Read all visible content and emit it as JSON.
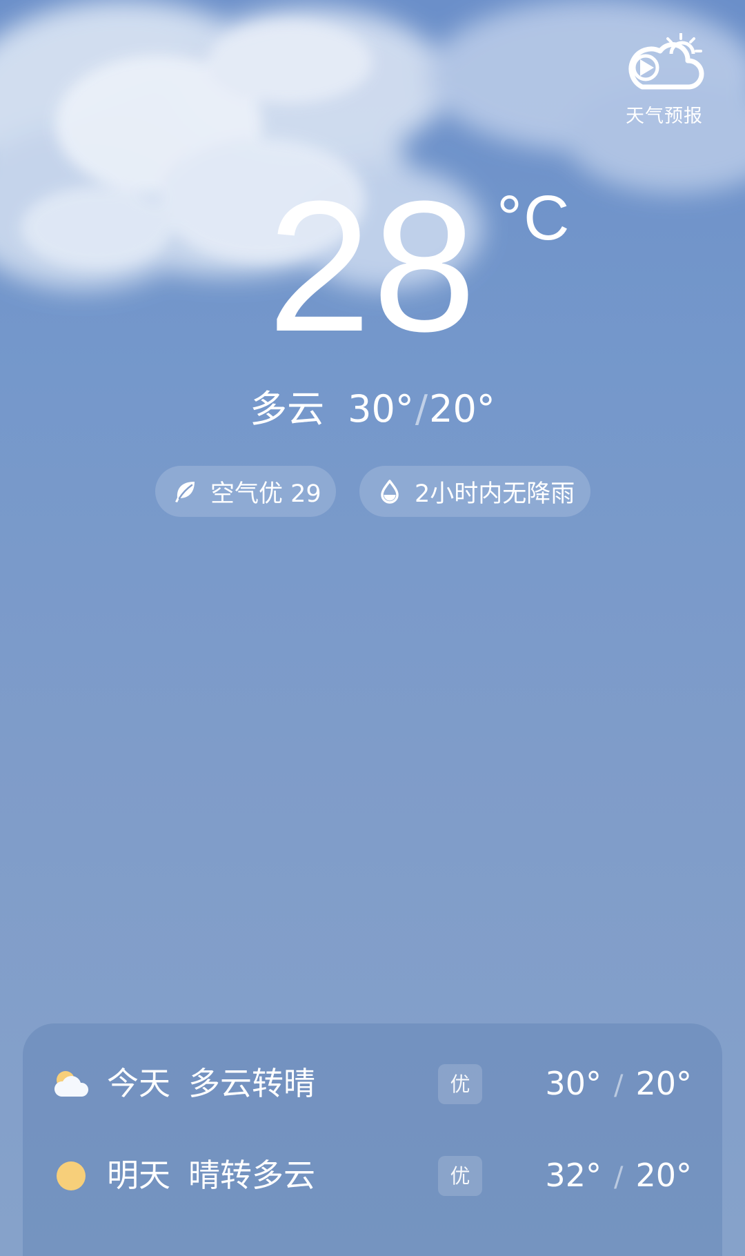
{
  "app": {
    "logo_icon": "video-weather-logo-icon",
    "logo_label": "天气预报"
  },
  "current": {
    "temperature": "28",
    "unit": "°C",
    "condition": "多云",
    "high": "30°",
    "separator": "/",
    "low": "20°"
  },
  "pills": {
    "air": {
      "icon": "leaf-icon",
      "label": "空气优 29"
    },
    "rain": {
      "icon": "raindrop-icon",
      "label": "2小时内无降雨"
    }
  },
  "forecast": [
    {
      "icon": "partly-cloudy-icon",
      "day": "今天",
      "condition": "多云转晴",
      "aqi": "优",
      "high": "30°",
      "separator": "/",
      "low": "20°"
    },
    {
      "icon": "sun-icon",
      "day": "明天",
      "condition": "晴转多云",
      "aqi": "优",
      "high": "32°",
      "separator": "/",
      "low": "20°"
    }
  ],
  "colors": {
    "sky_top": "#6b8fc9",
    "sky_bottom": "#86a2ca",
    "sun": "#f7cf7a",
    "text": "#ffffff"
  }
}
